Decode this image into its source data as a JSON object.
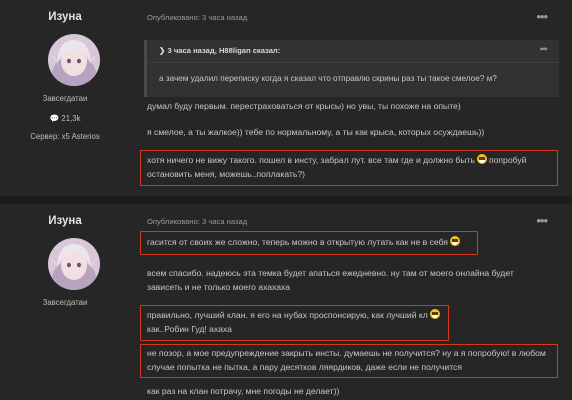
{
  "posts": [
    {
      "author": "Изуна",
      "rank": "Завсегдатаи",
      "reputation": "21,3k",
      "server": "Сервер: x5 Asterios",
      "meta": "Опубликовано: 3 часа назад",
      "quote": {
        "header": "3 часа назад, H88ligan сказал:",
        "text": "а зачем удалил переписку когда я сказал что отправлю скрины раз ты такое смелое? м?"
      },
      "lines": [
        "думал буду первым. перестраховаться от крысы) но увы, ты похоже на опыте)",
        "я смелое, а ты жалкое)) тебе по нормальному, а ты как крыса, которых осуждаешь))",
        "хотя ничего не вижу такого. пошел в инсту, забрал лут. все там где и должно быть",
        "попробуй",
        "остановить меня, можешь..поплакать?)"
      ]
    },
    {
      "author": "Изуна",
      "rank": "Завсегдатаи",
      "meta": "Опубликовано: 3 часа назад",
      "lines": [
        "гасится от своих же сложно, теперь можно в открытую лутать как не в себя",
        "всем спасибо. надеюсь эта темка будет апаться ежедневно. ну там от моего онлайна будет",
        "зависеть и не только моего ахахаха",
        "правильно, лучший клан. я его на нубах проспонсирую, как лучший кл",
        "как..Робин Гуд! ахаха",
        "не позор, а мое предупреждение закрыть инсты. думаешь не получится? ну а я попробую! в любом",
        "случае попытка не пытка, а пару десятков ляярдиков, даже если не получится",
        "как раз на клан потрачу, мне погоды не делает))"
      ]
    }
  ],
  "icons": {
    "more": "more-icon",
    "chevron": "chevron-icon",
    "share": "share-icon",
    "rep": "comment-icon",
    "emoji": "grin-emoji"
  },
  "colors": {
    "highlight": "#d4391e",
    "background": "#1c1c1d",
    "post_bg": "#262627"
  }
}
